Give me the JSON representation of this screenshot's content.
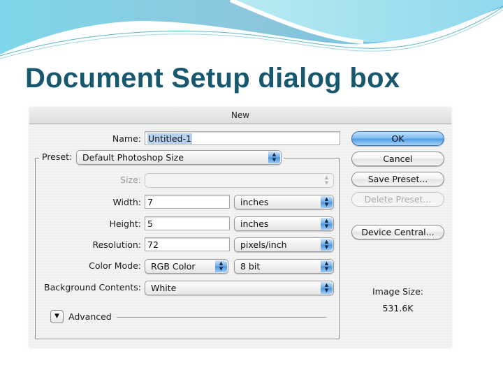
{
  "slide": {
    "title": "Document Setup dialog box"
  },
  "dialog": {
    "title": "New",
    "name": {
      "label": "Name:",
      "value": "Untitled-1"
    },
    "preset": {
      "label": "Preset:",
      "value": "Default Photoshop Size"
    },
    "size": {
      "label": "Size:",
      "value": "",
      "disabled": true
    },
    "width": {
      "label": "Width:",
      "value": "7",
      "unit": "inches"
    },
    "height": {
      "label": "Height:",
      "value": "5",
      "unit": "inches"
    },
    "resolution": {
      "label": "Resolution:",
      "value": "72",
      "unit": "pixels/inch"
    },
    "color_mode": {
      "label": "Color Mode:",
      "value": "RGB Color",
      "depth": "8 bit"
    },
    "background": {
      "label": "Background Contents:",
      "value": "White"
    },
    "advanced": {
      "label": "Advanced"
    },
    "buttons": {
      "ok": "OK",
      "cancel": "Cancel",
      "save_preset": "Save Preset...",
      "delete_preset": "Delete Preset...",
      "device_central": "Device Central..."
    },
    "image_size": {
      "label": "Image Size:",
      "value": "531.6K"
    }
  },
  "icons": {
    "updown": "▲▼",
    "disclosure": "▼"
  }
}
